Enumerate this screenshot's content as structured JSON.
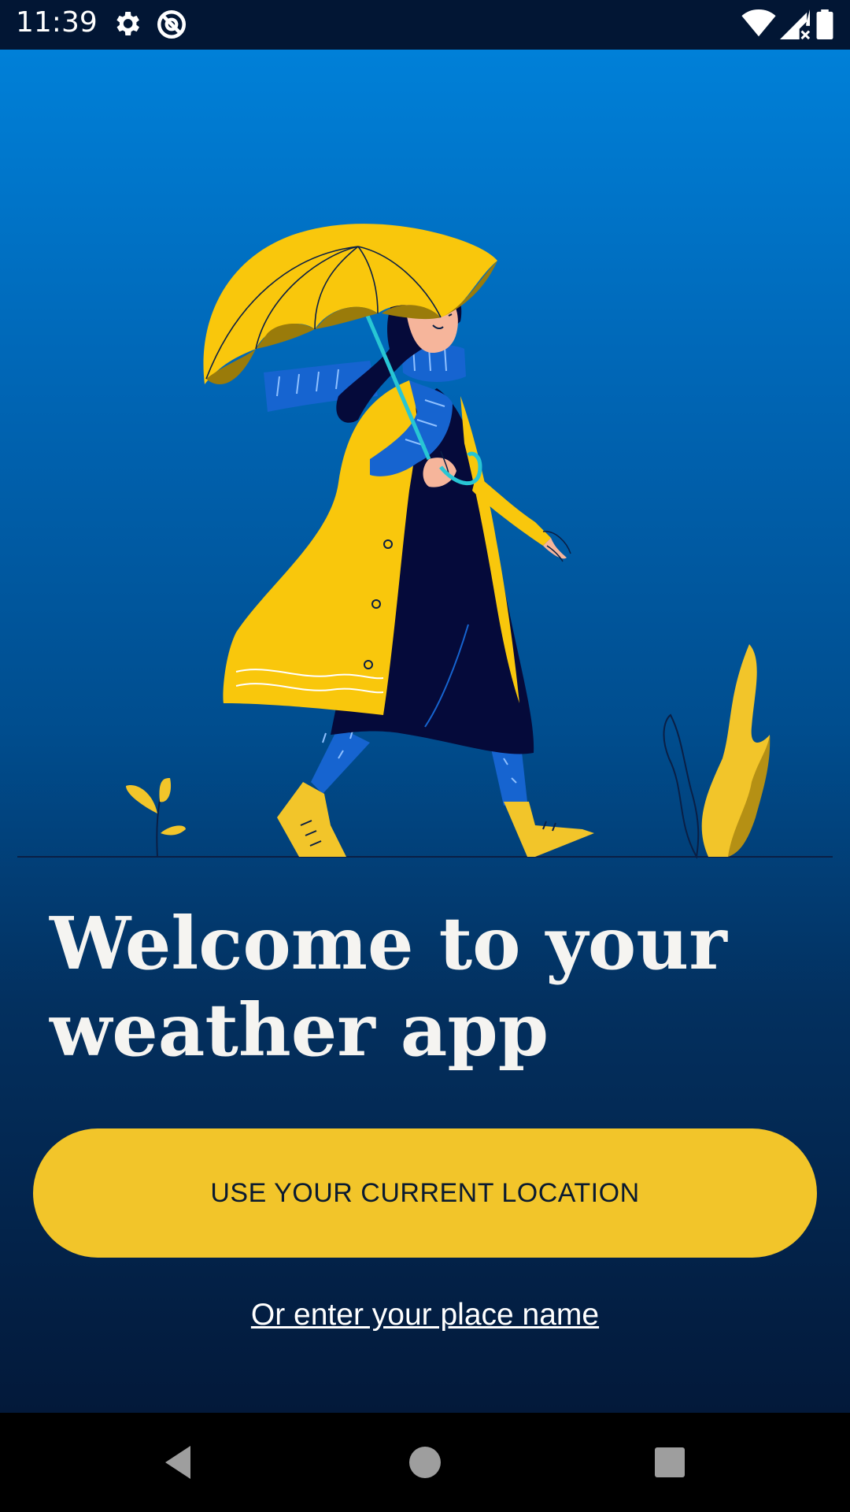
{
  "status_bar": {
    "time": "11:39",
    "icons": [
      "gear-icon",
      "no-sync-icon",
      "wifi-icon",
      "signal-icon",
      "battery-icon"
    ]
  },
  "main": {
    "illustration": "woman-with-umbrella-illustration",
    "title_line1": "Welcome to your",
    "title_line2": "weather app",
    "primary_button_label": "USE YOUR CURRENT LOCATION",
    "secondary_link_label": "Or enter your place name"
  },
  "nav_bar": {
    "icons": [
      "back-icon",
      "home-icon",
      "recents-icon"
    ]
  },
  "colors": {
    "accent": "#f2c52a",
    "background_top": "#0080d8",
    "background_bottom": "#03193a",
    "status_bar": "#021634"
  }
}
